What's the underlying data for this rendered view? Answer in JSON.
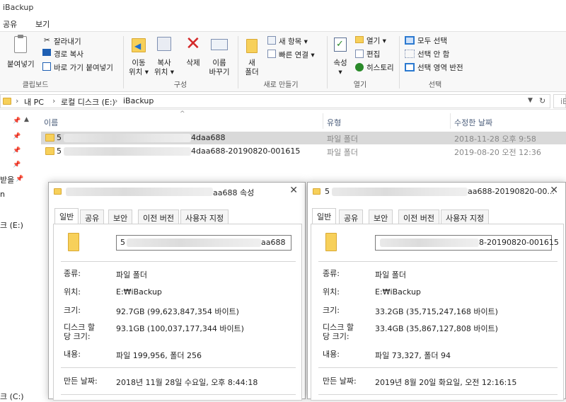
{
  "window": {
    "title": "iBackup"
  },
  "menu_tabs": [
    "공유",
    "보기"
  ],
  "ribbon": {
    "clipboard": {
      "paste": "붙여넣기",
      "cut": "잘라내기",
      "copy_path": "경로 복사",
      "paste_shortcut": "바로 가기 붙여넣기",
      "group": "클립보드"
    },
    "organize": {
      "move_l1": "이동",
      "move_l2": "위치 ▾",
      "copy_l1": "복사",
      "copy_l2": "위치 ▾",
      "delete": "삭제",
      "rename_l1": "이름",
      "rename_l2": "바꾸기",
      "group": "구성"
    },
    "new": {
      "new_folder_l1": "새",
      "new_folder_l2": "폴더",
      "new_item": "새 항목 ▾",
      "easy_access": "빠른 연결 ▾",
      "group": "새로 만들기"
    },
    "open": {
      "properties": "속성",
      "open": "열기 ▾",
      "edit": "편집",
      "history": "히스토리",
      "group": "열기"
    },
    "select": {
      "select_all": "모두 선택",
      "select_none": "선택 안 함",
      "invert": "선택 영역 반전",
      "group": "선택"
    }
  },
  "address": {
    "crumbs": [
      "내 PC",
      "로컬 디스크 (E:)",
      "iBackup"
    ],
    "search_fragment": "iB"
  },
  "file_list": {
    "columns": {
      "name": "이름",
      "type": "유형",
      "modified": "수정한 날짜"
    },
    "rows": [
      {
        "name_prefix": "5",
        "name_suffix": "4daa688",
        "type": "파일 폴더",
        "modified": "2018-11-28 오후 9:58"
      },
      {
        "name_prefix": "5",
        "name_suffix": "4daa688-20190820-001615",
        "type": "파일 폴더",
        "modified": "2019-08-20 오전 12:36"
      }
    ]
  },
  "nav_fragments": {
    "downloads": "받을",
    "item_n": "n",
    "drive_e": "크 (E:)",
    "drive_c": "크 (C:)"
  },
  "dialog1": {
    "title_suffix": "aa688 속성",
    "tabs": [
      "일반",
      "공유",
      "보안",
      "이전 버전",
      "사용자 지정"
    ],
    "name_prefix": "5",
    "name_suffix": "aa688",
    "type_label": "종류:",
    "type": "파일 폴더",
    "location_label": "위치:",
    "location": "E:₩iBackup",
    "size_label": "크기:",
    "size": "92.7GB (99,623,847,354 바이트)",
    "disk_size_label_l1": "디스크 할",
    "disk_size_label_l2": "당 크기:",
    "disk_size": "93.1GB (100,037,177,344 바이트)",
    "contents_label": "내용:",
    "contents": "파일 199,956, 폴더 256",
    "created_label": "만든 날짜:",
    "created": "2018년 11월 28일 수요일, 오후 8:44:18"
  },
  "dialog2": {
    "title_prefix": "5",
    "title_suffix": "aa688-20190820-00...",
    "tabs": [
      "일반",
      "공유",
      "보안",
      "이전 버전",
      "사용자 지정"
    ],
    "name_suffix": "8-20190820-001615",
    "type_label": "종류:",
    "type": "파일 폴더",
    "location_label": "위치:",
    "location": "E:₩iBackup",
    "size_label": "크기:",
    "size": "33.2GB (35,715,247,168 바이트)",
    "disk_size_label_l1": "디스크 할",
    "disk_size_label_l2": "당 크기:",
    "disk_size": "33.4GB (35,867,127,808 바이트)",
    "contents_label": "내용:",
    "contents": "파일 73,327, 폴더 94",
    "created_label": "만든 날짜:",
    "created": "2019년 8월 20일 화요일, 오전 12:16:15"
  },
  "colors": {
    "folder": "#f7d05a",
    "selected_row": "#d9d9d9",
    "header_text": "#4a5c7a",
    "delete_red": "#d42a2a",
    "select_blue": "#2b79d0"
  }
}
